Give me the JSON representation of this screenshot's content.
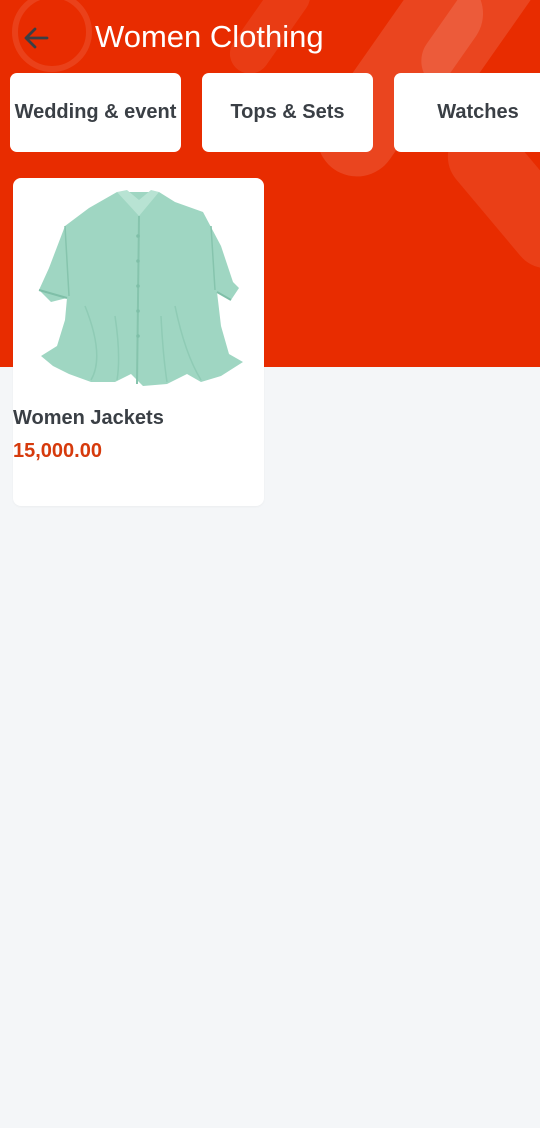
{
  "header": {
    "title": "Women Clothing",
    "back_icon": "arrow-left-icon",
    "background_color": "#e82c00"
  },
  "categories": [
    {
      "label": "Wedding & event"
    },
    {
      "label": "Tops & Sets"
    },
    {
      "label": "Watches"
    }
  ],
  "products": [
    {
      "name": "Women Jackets",
      "price": "15,000.00",
      "image": "mint-green-blouse",
      "price_color": "#d63a0c"
    }
  ]
}
